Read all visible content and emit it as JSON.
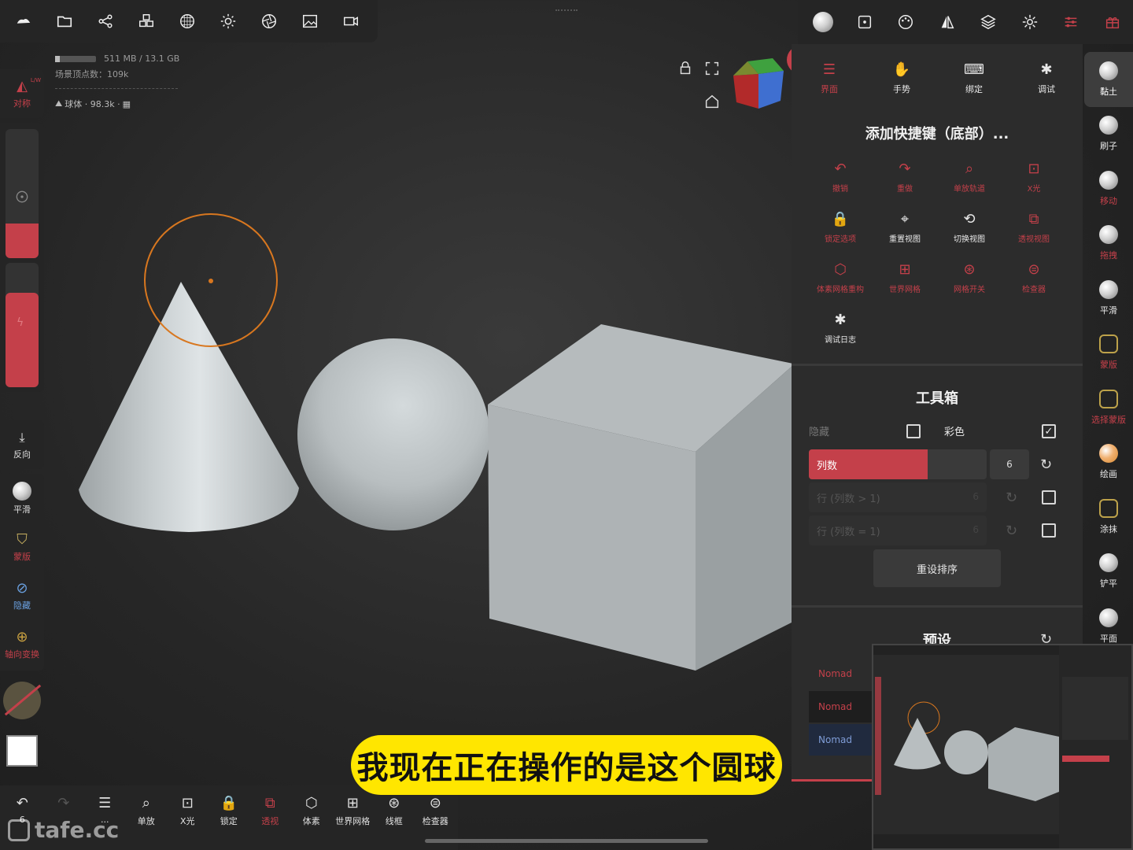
{
  "top_left_toolbar": {
    "icons": [
      "cloud-icon",
      "folder-icon",
      "share-icon",
      "cubes-icon",
      "grid-sphere-icon",
      "sun-icon",
      "aperture-icon",
      "image-icon",
      "camera-icon"
    ]
  },
  "top_right_toolbar": {
    "icons": [
      "material-sphere-icon",
      "viewport-icon",
      "palette-icon",
      "mirror-icon",
      "layers-icon",
      "settings-icon",
      "sliders-icon",
      "gift-icon"
    ]
  },
  "stats": {
    "memory": "511 MB / 13.1 GB",
    "vertex_count": "场景顶点数：109k",
    "object_info": "球体 · 98.3k ·"
  },
  "left_sidebar": {
    "symmetry_label": "对称",
    "symmetry_tag": "L/W",
    "reverse_label": "反向",
    "smooth_label": "平滑",
    "mask_label": "蒙版",
    "hide_label": "隐藏",
    "axis_label": "轴向变换"
  },
  "right_tools": [
    {
      "label": "黏土",
      "color": "#ffffff",
      "active": true
    },
    {
      "label": "刷子",
      "color": "#e8e8e8"
    },
    {
      "label": "移动",
      "color": "#c4404a"
    },
    {
      "label": "拖拽",
      "color": "#c4404a"
    },
    {
      "label": "平滑",
      "color": "#e8e8e8"
    },
    {
      "label": "蒙版",
      "color": "#c4404a"
    },
    {
      "label": "选择蒙版",
      "color": "#c4404a"
    },
    {
      "label": "绘画",
      "color": "#e8e8e8"
    },
    {
      "label": "涂抹",
      "color": "#e8e8e8"
    },
    {
      "label": "铲平",
      "color": "#e8e8e8"
    },
    {
      "label": "平面",
      "color": "#e8e8e8"
    }
  ],
  "settings_panel": {
    "tabs": [
      {
        "label": "界面",
        "active": true
      },
      {
        "label": "手势"
      },
      {
        "label": "绑定"
      },
      {
        "label": "调试"
      }
    ],
    "shortcut_title": "添加快捷键（底部）...",
    "shortcuts": [
      {
        "label": "撤销",
        "active": false
      },
      {
        "label": "重做",
        "active": false
      },
      {
        "label": "单放轨道",
        "active": false
      },
      {
        "label": "X光",
        "active": false
      },
      {
        "label": "锁定选项",
        "active": false
      },
      {
        "label": "重置视图",
        "active": true
      },
      {
        "label": "切换视图",
        "active": true
      },
      {
        "label": "透视视图",
        "active": false
      },
      {
        "label": "体素网格重构",
        "active": false
      },
      {
        "label": "世界网格",
        "active": false
      },
      {
        "label": "网格开关",
        "active": false
      },
      {
        "label": "检查器",
        "active": false
      },
      {
        "label": "调试日志",
        "active": true
      }
    ],
    "toolbox_title": "工具箱",
    "hide_label": "隐藏",
    "color_label": "彩色",
    "columns_label": "列数",
    "columns_value": "6",
    "rows_label_1": "行 (列数 > 1)",
    "rows_value_1": "6",
    "rows_label_2": "行 (列数 = 1)",
    "rows_value_2": "6",
    "reset_order": "重设排序",
    "presets_title": "预设",
    "presets": [
      "Nomad",
      "Nomad",
      "Nomad"
    ]
  },
  "bottom_toolbar": [
    {
      "label": "6",
      "icon": "undo-icon",
      "color": "#e0e0e0"
    },
    {
      "label": "",
      "icon": "redo-icon",
      "color": "#555555"
    },
    {
      "label": "...",
      "icon": "book-icon",
      "color": "#e0e0e0"
    },
    {
      "label": "单放",
      "icon": "search-icon",
      "color": "#e0e0e0"
    },
    {
      "label": "X光",
      "icon": "xray-icon",
      "color": "#e0e0e0"
    },
    {
      "label": "锁定",
      "icon": "lock-icon",
      "color": "#e0e0e0"
    },
    {
      "label": "透视",
      "icon": "perspective-icon",
      "color": "#c4404a"
    },
    {
      "label": "体素",
      "icon": "voxel-icon",
      "color": "#e0e0e0"
    },
    {
      "label": "世界网格",
      "icon": "world-grid-icon",
      "color": "#e0e0e0"
    },
    {
      "label": "线框",
      "icon": "wireframe-icon",
      "color": "#e0e0e0"
    },
    {
      "label": "检查器",
      "icon": "inspector-icon",
      "color": "#e0e0e0"
    }
  ],
  "subtitle": "我现在正在操作的是这个圆球",
  "watermark": "tafe.cc",
  "colors": {
    "accent": "#c4404a",
    "subtitle_bg": "#ffe600",
    "brush_ring": "#d8771f"
  }
}
